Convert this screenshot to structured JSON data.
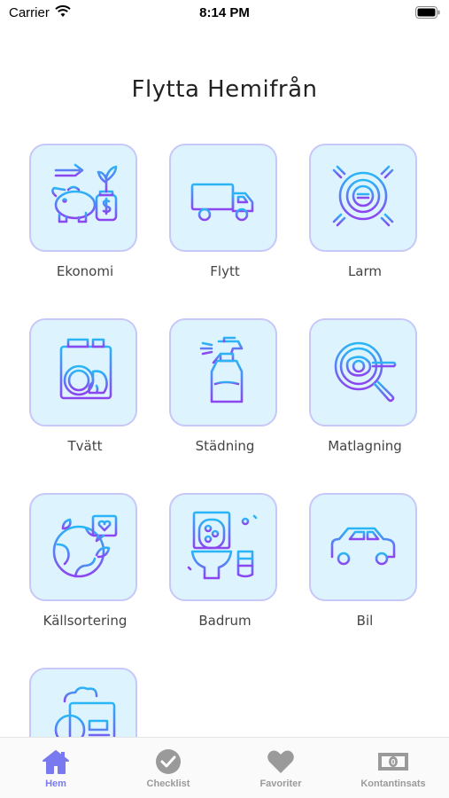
{
  "status_bar": {
    "carrier": "Carrier",
    "time": "8:14 PM"
  },
  "page": {
    "title": "Flytta Hemifrån"
  },
  "categories": [
    {
      "label": "Ekonomi",
      "icon": "piggy-bank-icon"
    },
    {
      "label": "Flytt",
      "icon": "moving-truck-icon"
    },
    {
      "label": "Larm",
      "icon": "alarm-sensor-icon"
    },
    {
      "label": "Tvätt",
      "icon": "washing-machine-icon"
    },
    {
      "label": "Städning",
      "icon": "spray-bottle-icon"
    },
    {
      "label": "Matlagning",
      "icon": "frying-pan-icon"
    },
    {
      "label": "Källsortering",
      "icon": "earth-recycling-icon"
    },
    {
      "label": "Badrum",
      "icon": "toilet-icon"
    },
    {
      "label": "Bil",
      "icon": "car-icon"
    },
    {
      "label": "",
      "icon": "info-document-icon"
    }
  ],
  "tabbar": {
    "tabs": [
      {
        "label": "Hem",
        "icon": "home-icon",
        "active": true
      },
      {
        "label": "Checklist",
        "icon": "checkmark-circle-icon",
        "active": false
      },
      {
        "label": "Favoriter",
        "icon": "heart-icon",
        "active": false
      },
      {
        "label": "Kontantinsats",
        "icon": "banknote-icon",
        "active": false
      }
    ]
  },
  "colors": {
    "accent": "#7a7af0",
    "tile_bg": "#ddf4ff",
    "tile_border": "#c7c8f7",
    "icon_gradient_start": "#29b6f6",
    "icon_gradient_end": "#8e44f0"
  }
}
